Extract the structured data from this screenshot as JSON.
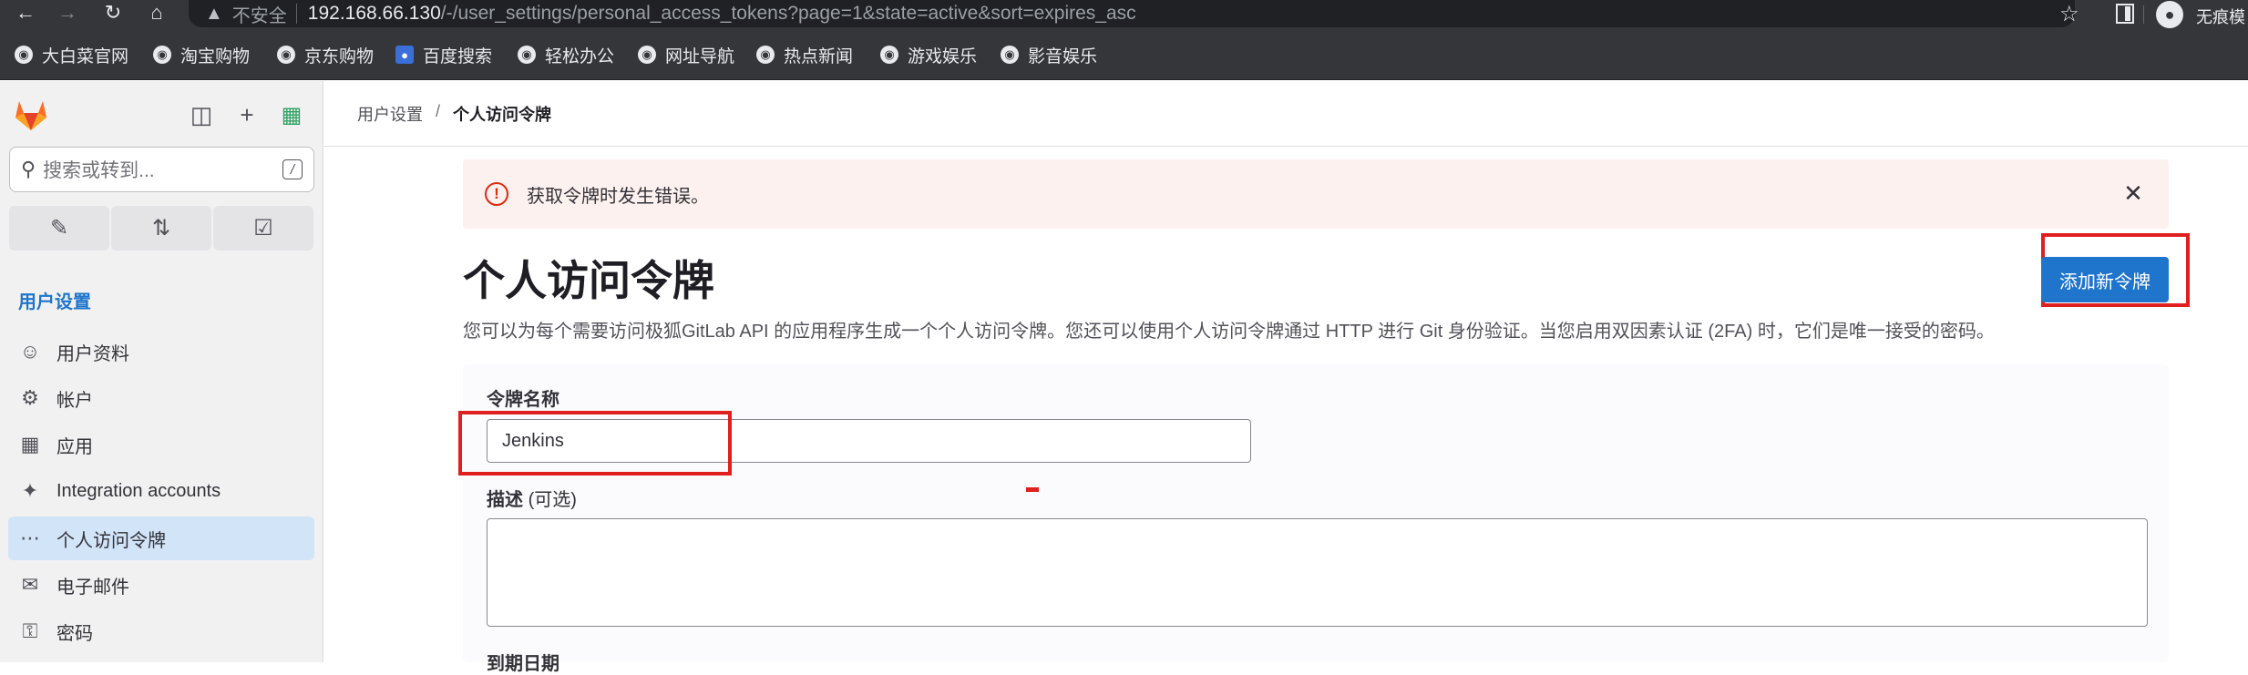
{
  "browser": {
    "insecure_label": "不安全",
    "url_host": "192.168.66.130",
    "url_path": "/-/user_settings/personal_access_tokens?page=1&state=active&sort=expires_asc",
    "profile_label": "无痕模"
  },
  "bookmarks": [
    {
      "label": "大白菜官网",
      "icon": "globe-icon"
    },
    {
      "label": "淘宝购物",
      "icon": "globe-icon"
    },
    {
      "label": "京东购物",
      "icon": "globe-icon"
    },
    {
      "label": "百度搜索",
      "icon": "baidu-paw-icon"
    },
    {
      "label": "轻松办公",
      "icon": "globe-icon"
    },
    {
      "label": "网址导航",
      "icon": "globe-icon"
    },
    {
      "label": "热点新闻",
      "icon": "globe-icon"
    },
    {
      "label": "游戏娱乐",
      "icon": "globe-icon"
    },
    {
      "label": "影音娱乐",
      "icon": "globe-icon"
    }
  ],
  "sidebar": {
    "search_placeholder": "搜索或转到...",
    "search_shortcut": "/",
    "section_title": "用户设置",
    "items": [
      {
        "label": "用户资料",
        "icon": "profile-icon",
        "active": false
      },
      {
        "label": "帐户",
        "icon": "account-icon",
        "active": false
      },
      {
        "label": "应用",
        "icon": "applications-icon",
        "active": false
      },
      {
        "label": "Integration accounts",
        "icon": "plug-icon",
        "active": false
      },
      {
        "label": "个人访问令牌",
        "icon": "token-icon",
        "active": true
      },
      {
        "label": "电子邮件",
        "icon": "mail-icon",
        "active": false
      },
      {
        "label": "密码",
        "icon": "lock-icon",
        "active": false
      }
    ]
  },
  "breadcrumb": {
    "parent": "用户设置",
    "separator": "/",
    "current": "个人访问令牌"
  },
  "alert": {
    "message": "获取令牌时发生错误。"
  },
  "page": {
    "title": "个人访问令牌",
    "add_button": "添加新令牌",
    "description": "您可以为每个需要访问极狐GitLab API 的应用程序生成一个个人访问令牌。您还可以使用个人访问令牌通过 HTTP 进行 Git 身份验证。当您启用双因素认证 (2FA) 时，它们是唯一接受的密码。"
  },
  "form": {
    "name_label": "令牌名称",
    "name_value": "Jenkins",
    "desc_label": "描述",
    "desc_optional": "(可选)",
    "desc_value": "",
    "expiry_label": "到期日期"
  },
  "colors": {
    "accent": "#1f75cb",
    "alert_bg": "#fcf1ef",
    "alert_icon": "#dd2b0e",
    "annotation_red": "#e01f1f"
  }
}
